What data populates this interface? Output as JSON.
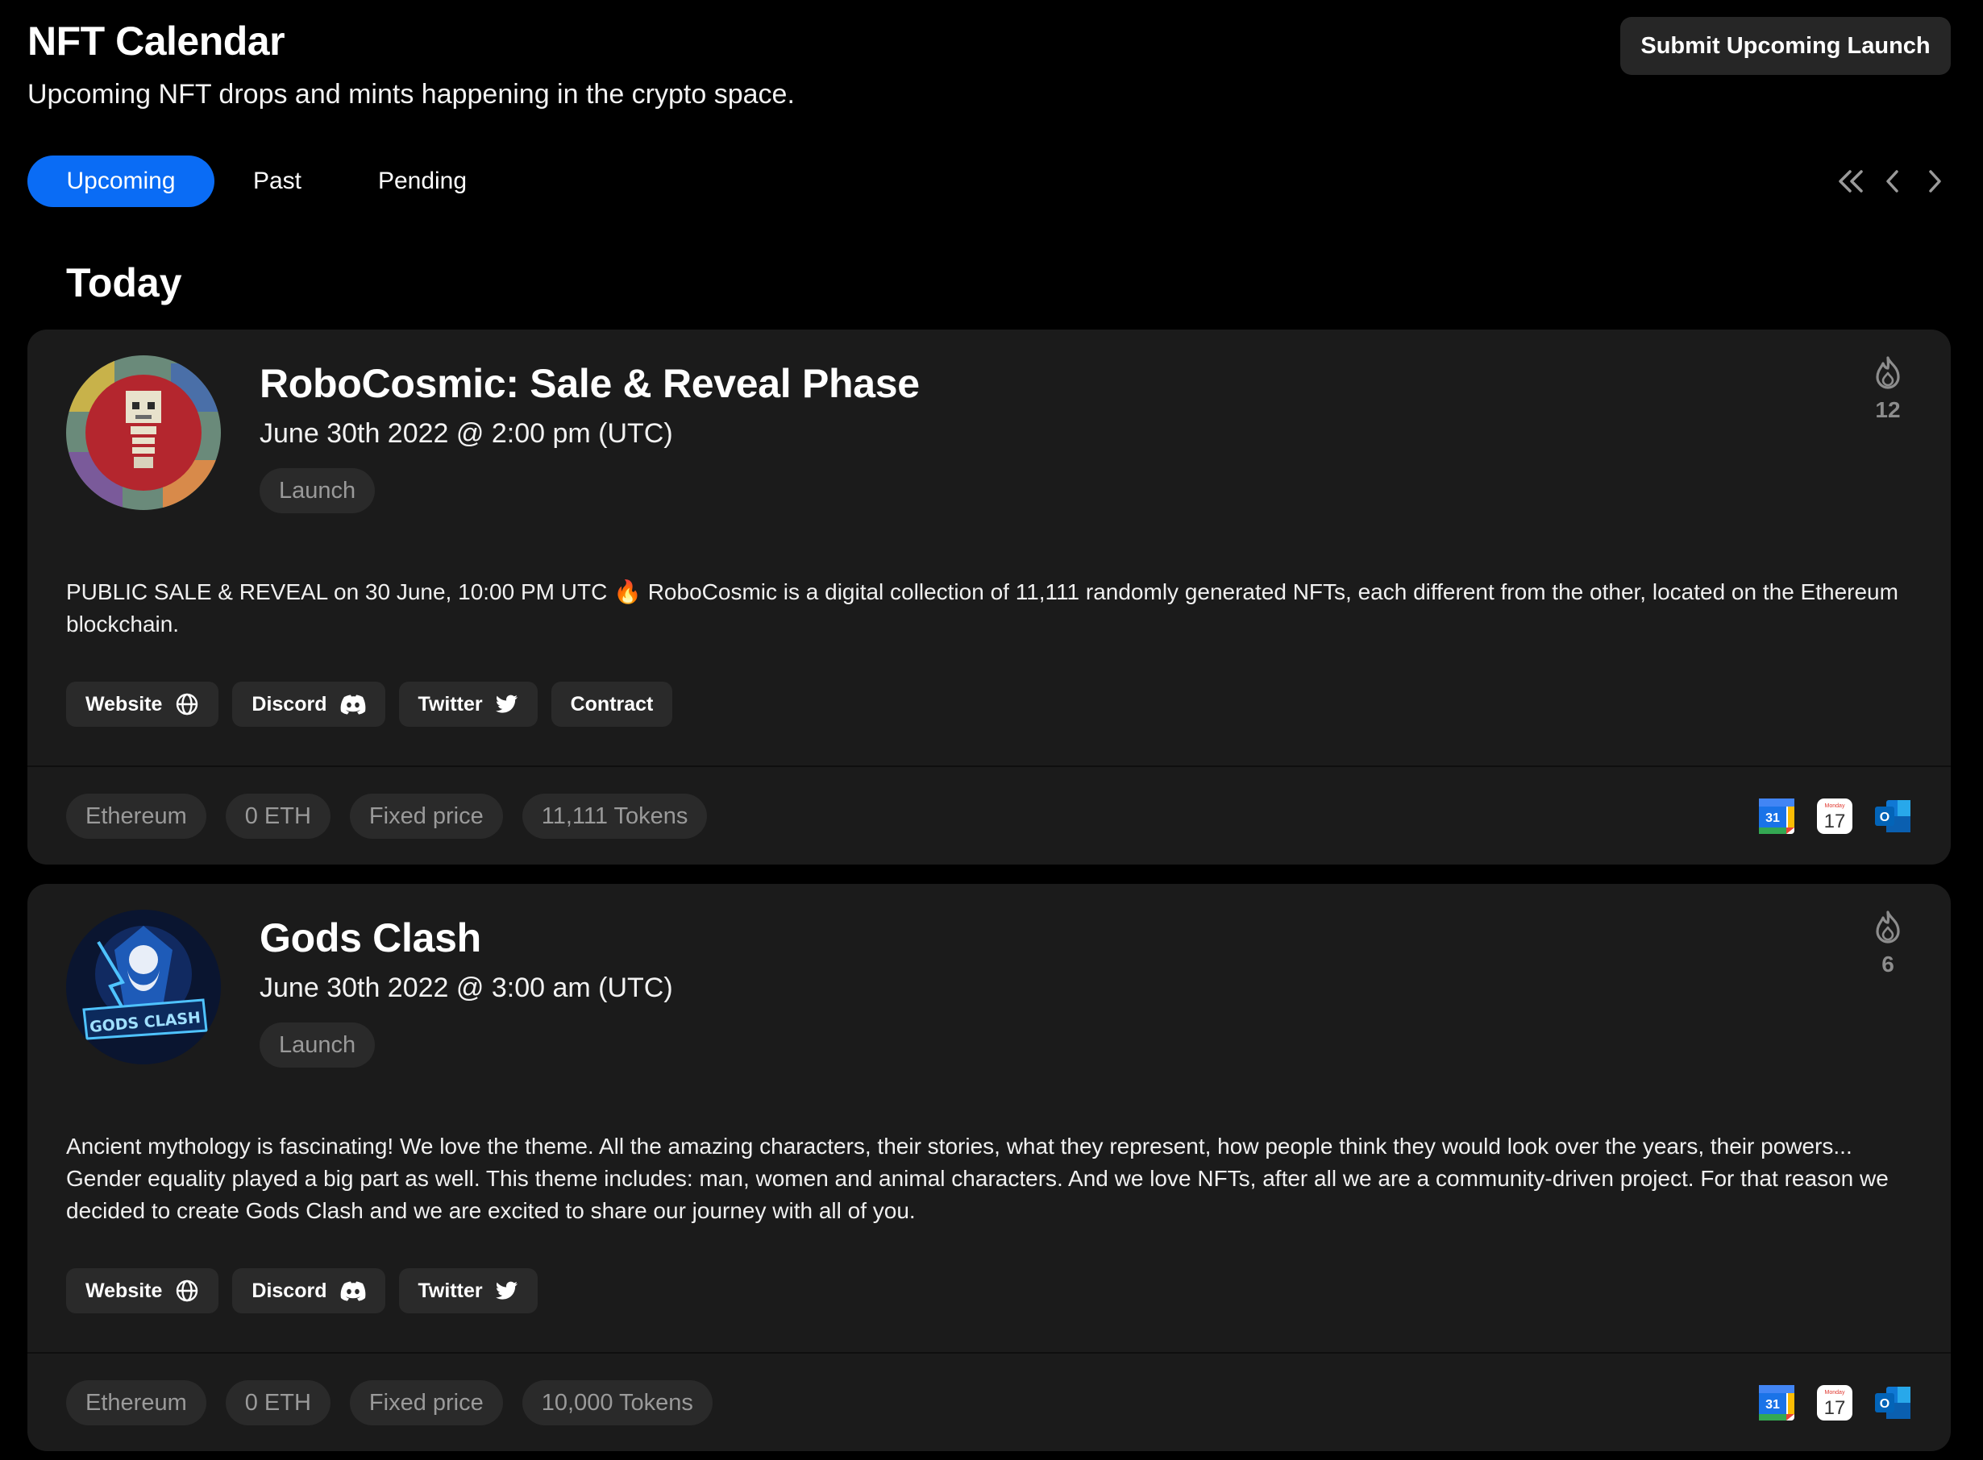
{
  "header": {
    "title": "NFT Calendar",
    "subtitle": "Upcoming NFT drops and mints happening in the crypto space.",
    "submit_label": "Submit Upcoming Launch"
  },
  "tabs": [
    {
      "label": "Upcoming",
      "active": true
    },
    {
      "label": "Past",
      "active": false
    },
    {
      "label": "Pending",
      "active": false
    }
  ],
  "section_heading": "Today",
  "colors": {
    "accent": "#0a6cf5",
    "card": "#1b1b1b",
    "pill": "#2a2a2a"
  },
  "cards": [
    {
      "title": "RoboCosmic: Sale & Reveal Phase",
      "date": "June 30th 2022 @ 2:00 pm (UTC)",
      "tag": "Launch",
      "fire_count": "12",
      "description": "PUBLIC SALE & REVEAL on 30 June, 10:00 PM UTC 🔥 RoboCosmic is a digital collection of 11,111 randomly generated NFTs, each different from the other, located on the Ethereum blockchain.",
      "links": [
        {
          "label": "Website",
          "icon": "globe-icon"
        },
        {
          "label": "Discord",
          "icon": "discord-icon"
        },
        {
          "label": "Twitter",
          "icon": "twitter-icon"
        },
        {
          "label": "Contract",
          "icon": ""
        }
      ],
      "meta": [
        "Ethereum",
        "0 ETH",
        "Fixed price",
        "11,111 Tokens"
      ]
    },
    {
      "title": "Gods Clash",
      "date": "June 30th 2022 @ 3:00 am (UTC)",
      "tag": "Launch",
      "fire_count": "6",
      "description": "Ancient mythology is fascinating! We love the theme. All the amazing characters, their stories, what they represent, how people think they would look over the years, their powers... Gender equality played a big part as well. This theme includes: man, women and animal characters. And we love NFTs, after all we are a community-driven project. For that reason we decided to create Gods Clash and we are excited to share our journey with all of you.",
      "avatar_text": "GODS CLASH",
      "links": [
        {
          "label": "Website",
          "icon": "globe-icon"
        },
        {
          "label": "Discord",
          "icon": "discord-icon"
        },
        {
          "label": "Twitter",
          "icon": "twitter-icon"
        }
      ],
      "meta": [
        "Ethereum",
        "0 ETH",
        "Fixed price",
        "10,000 Tokens"
      ]
    }
  ],
  "calendar_icons": {
    "google_day": "31",
    "apple_day": "17",
    "apple_weekday": "Monday",
    "outlook_letter": "O"
  }
}
